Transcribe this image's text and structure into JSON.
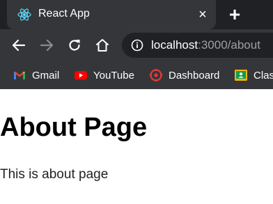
{
  "browser": {
    "tab": {
      "title": "React App",
      "close_symbol": "×",
      "favicon": "react-icon"
    },
    "new_tab_symbol": "+",
    "toolbar": {
      "back": "back-arrow-icon",
      "forward": "forward-arrow-icon",
      "reload": "reload-icon",
      "home": "home-icon"
    },
    "address": {
      "host": "localhost",
      "rest": ":3000/about",
      "info_icon": "info-icon"
    },
    "bookmarks": [
      {
        "label": "Gmail",
        "icon": "gmail-icon"
      },
      {
        "label": "YouTube",
        "icon": "youtube-icon"
      },
      {
        "label": "Dashboard",
        "icon": "dashboard-icon"
      },
      {
        "label": "Clas",
        "icon": "classroom-icon"
      }
    ]
  },
  "page": {
    "title": "About Page",
    "text": "This is about page"
  },
  "colors": {
    "tab_strip": "#202124",
    "toolbar": "#35363a",
    "react": "#61dafb",
    "youtube": "#ff0000",
    "dashboard": "#e53935",
    "classroom": "#f5b400"
  }
}
